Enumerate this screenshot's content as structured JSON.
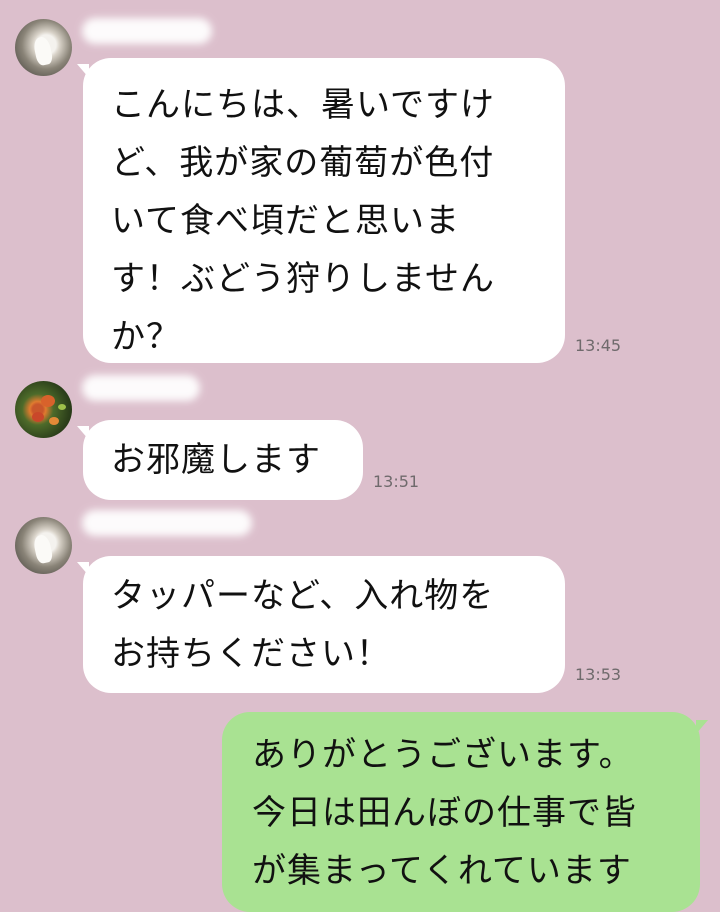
{
  "messages": [
    {
      "side": "incoming",
      "avatar": "dog-avatar",
      "text": "こんにちは、暑いですけ\nど、我が家の葡萄が色付\nいて食べ頃だと思いま\nす！ぶどう狩りしません\nか？",
      "time": "13:45"
    },
    {
      "side": "incoming",
      "avatar": "plant-avatar",
      "text": "お邪魔します",
      "time": "13:51"
    },
    {
      "side": "incoming",
      "avatar": "dog-avatar",
      "text": "タッパーなど、入れ物を\nお持ちください！",
      "time": "13:53"
    },
    {
      "side": "outgoing",
      "text": "ありがとうございます。\n今日は田んぼの仕事で皆\nが集まってくれています"
    }
  ]
}
